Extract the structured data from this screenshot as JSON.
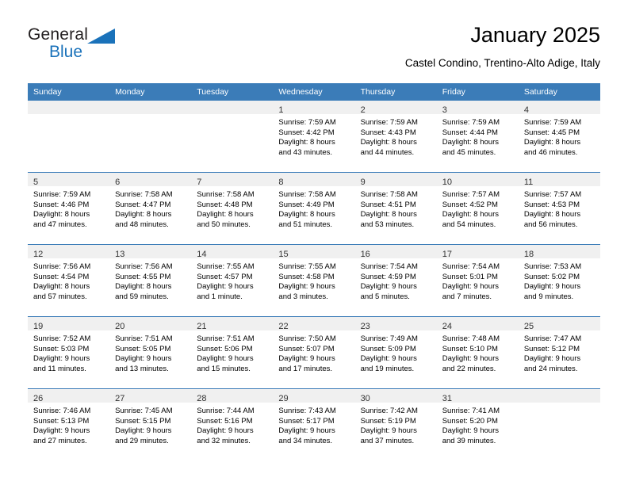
{
  "brand": {
    "name_part1": "General",
    "name_part2": "Blue",
    "triangle_color": "#1a72ba"
  },
  "header": {
    "title": "January 2025",
    "subtitle": "Castel Condino, Trentino-Alto Adige, Italy"
  },
  "theme": {
    "header_bg": "#3b7cb8",
    "header_text": "#ffffff",
    "daynum_band_bg": "#f0f0f0",
    "grid_line": "#3b7cb8"
  },
  "weekdays": [
    "Sunday",
    "Monday",
    "Tuesday",
    "Wednesday",
    "Thursday",
    "Friday",
    "Saturday"
  ],
  "weeks": [
    [
      {
        "day": "",
        "sunrise": "",
        "sunset": "",
        "daylight1": "",
        "daylight2": ""
      },
      {
        "day": "",
        "sunrise": "",
        "sunset": "",
        "daylight1": "",
        "daylight2": ""
      },
      {
        "day": "",
        "sunrise": "",
        "sunset": "",
        "daylight1": "",
        "daylight2": ""
      },
      {
        "day": "1",
        "sunrise": "Sunrise: 7:59 AM",
        "sunset": "Sunset: 4:42 PM",
        "daylight1": "Daylight: 8 hours",
        "daylight2": "and 43 minutes."
      },
      {
        "day": "2",
        "sunrise": "Sunrise: 7:59 AM",
        "sunset": "Sunset: 4:43 PM",
        "daylight1": "Daylight: 8 hours",
        "daylight2": "and 44 minutes."
      },
      {
        "day": "3",
        "sunrise": "Sunrise: 7:59 AM",
        "sunset": "Sunset: 4:44 PM",
        "daylight1": "Daylight: 8 hours",
        "daylight2": "and 45 minutes."
      },
      {
        "day": "4",
        "sunrise": "Sunrise: 7:59 AM",
        "sunset": "Sunset: 4:45 PM",
        "daylight1": "Daylight: 8 hours",
        "daylight2": "and 46 minutes."
      }
    ],
    [
      {
        "day": "5",
        "sunrise": "Sunrise: 7:59 AM",
        "sunset": "Sunset: 4:46 PM",
        "daylight1": "Daylight: 8 hours",
        "daylight2": "and 47 minutes."
      },
      {
        "day": "6",
        "sunrise": "Sunrise: 7:58 AM",
        "sunset": "Sunset: 4:47 PM",
        "daylight1": "Daylight: 8 hours",
        "daylight2": "and 48 minutes."
      },
      {
        "day": "7",
        "sunrise": "Sunrise: 7:58 AM",
        "sunset": "Sunset: 4:48 PM",
        "daylight1": "Daylight: 8 hours",
        "daylight2": "and 50 minutes."
      },
      {
        "day": "8",
        "sunrise": "Sunrise: 7:58 AM",
        "sunset": "Sunset: 4:49 PM",
        "daylight1": "Daylight: 8 hours",
        "daylight2": "and 51 minutes."
      },
      {
        "day": "9",
        "sunrise": "Sunrise: 7:58 AM",
        "sunset": "Sunset: 4:51 PM",
        "daylight1": "Daylight: 8 hours",
        "daylight2": "and 53 minutes."
      },
      {
        "day": "10",
        "sunrise": "Sunrise: 7:57 AM",
        "sunset": "Sunset: 4:52 PM",
        "daylight1": "Daylight: 8 hours",
        "daylight2": "and 54 minutes."
      },
      {
        "day": "11",
        "sunrise": "Sunrise: 7:57 AM",
        "sunset": "Sunset: 4:53 PM",
        "daylight1": "Daylight: 8 hours",
        "daylight2": "and 56 minutes."
      }
    ],
    [
      {
        "day": "12",
        "sunrise": "Sunrise: 7:56 AM",
        "sunset": "Sunset: 4:54 PM",
        "daylight1": "Daylight: 8 hours",
        "daylight2": "and 57 minutes."
      },
      {
        "day": "13",
        "sunrise": "Sunrise: 7:56 AM",
        "sunset": "Sunset: 4:55 PM",
        "daylight1": "Daylight: 8 hours",
        "daylight2": "and 59 minutes."
      },
      {
        "day": "14",
        "sunrise": "Sunrise: 7:55 AM",
        "sunset": "Sunset: 4:57 PM",
        "daylight1": "Daylight: 9 hours",
        "daylight2": "and 1 minute."
      },
      {
        "day": "15",
        "sunrise": "Sunrise: 7:55 AM",
        "sunset": "Sunset: 4:58 PM",
        "daylight1": "Daylight: 9 hours",
        "daylight2": "and 3 minutes."
      },
      {
        "day": "16",
        "sunrise": "Sunrise: 7:54 AM",
        "sunset": "Sunset: 4:59 PM",
        "daylight1": "Daylight: 9 hours",
        "daylight2": "and 5 minutes."
      },
      {
        "day": "17",
        "sunrise": "Sunrise: 7:54 AM",
        "sunset": "Sunset: 5:01 PM",
        "daylight1": "Daylight: 9 hours",
        "daylight2": "and 7 minutes."
      },
      {
        "day": "18",
        "sunrise": "Sunrise: 7:53 AM",
        "sunset": "Sunset: 5:02 PM",
        "daylight1": "Daylight: 9 hours",
        "daylight2": "and 9 minutes."
      }
    ],
    [
      {
        "day": "19",
        "sunrise": "Sunrise: 7:52 AM",
        "sunset": "Sunset: 5:03 PM",
        "daylight1": "Daylight: 9 hours",
        "daylight2": "and 11 minutes."
      },
      {
        "day": "20",
        "sunrise": "Sunrise: 7:51 AM",
        "sunset": "Sunset: 5:05 PM",
        "daylight1": "Daylight: 9 hours",
        "daylight2": "and 13 minutes."
      },
      {
        "day": "21",
        "sunrise": "Sunrise: 7:51 AM",
        "sunset": "Sunset: 5:06 PM",
        "daylight1": "Daylight: 9 hours",
        "daylight2": "and 15 minutes."
      },
      {
        "day": "22",
        "sunrise": "Sunrise: 7:50 AM",
        "sunset": "Sunset: 5:07 PM",
        "daylight1": "Daylight: 9 hours",
        "daylight2": "and 17 minutes."
      },
      {
        "day": "23",
        "sunrise": "Sunrise: 7:49 AM",
        "sunset": "Sunset: 5:09 PM",
        "daylight1": "Daylight: 9 hours",
        "daylight2": "and 19 minutes."
      },
      {
        "day": "24",
        "sunrise": "Sunrise: 7:48 AM",
        "sunset": "Sunset: 5:10 PM",
        "daylight1": "Daylight: 9 hours",
        "daylight2": "and 22 minutes."
      },
      {
        "day": "25",
        "sunrise": "Sunrise: 7:47 AM",
        "sunset": "Sunset: 5:12 PM",
        "daylight1": "Daylight: 9 hours",
        "daylight2": "and 24 minutes."
      }
    ],
    [
      {
        "day": "26",
        "sunrise": "Sunrise: 7:46 AM",
        "sunset": "Sunset: 5:13 PM",
        "daylight1": "Daylight: 9 hours",
        "daylight2": "and 27 minutes."
      },
      {
        "day": "27",
        "sunrise": "Sunrise: 7:45 AM",
        "sunset": "Sunset: 5:15 PM",
        "daylight1": "Daylight: 9 hours",
        "daylight2": "and 29 minutes."
      },
      {
        "day": "28",
        "sunrise": "Sunrise: 7:44 AM",
        "sunset": "Sunset: 5:16 PM",
        "daylight1": "Daylight: 9 hours",
        "daylight2": "and 32 minutes."
      },
      {
        "day": "29",
        "sunrise": "Sunrise: 7:43 AM",
        "sunset": "Sunset: 5:17 PM",
        "daylight1": "Daylight: 9 hours",
        "daylight2": "and 34 minutes."
      },
      {
        "day": "30",
        "sunrise": "Sunrise: 7:42 AM",
        "sunset": "Sunset: 5:19 PM",
        "daylight1": "Daylight: 9 hours",
        "daylight2": "and 37 minutes."
      },
      {
        "day": "31",
        "sunrise": "Sunrise: 7:41 AM",
        "sunset": "Sunset: 5:20 PM",
        "daylight1": "Daylight: 9 hours",
        "daylight2": "and 39 minutes."
      },
      {
        "day": "",
        "sunrise": "",
        "sunset": "",
        "daylight1": "",
        "daylight2": ""
      }
    ]
  ]
}
